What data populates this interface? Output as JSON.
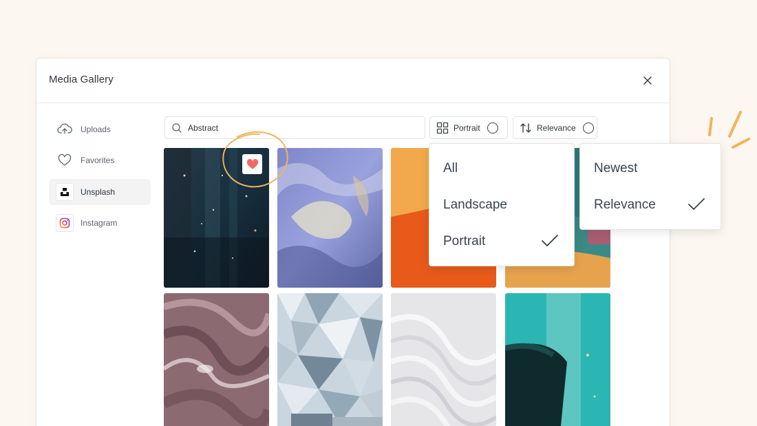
{
  "dialog": {
    "title": "Media Gallery"
  },
  "sidebar": {
    "items": [
      {
        "label": "Uploads",
        "icon": "cloud-upload-icon"
      },
      {
        "label": "Favorites",
        "icon": "heart-outline-icon"
      },
      {
        "label": "Unsplash",
        "icon": "unsplash-logo-icon",
        "active": true
      },
      {
        "label": "Instagram",
        "icon": "instagram-logo-icon"
      }
    ]
  },
  "search": {
    "value": "Abstract",
    "placeholder": ""
  },
  "filters": {
    "orientation": {
      "label": "Portrait",
      "icon": "grid-icon"
    },
    "sort": {
      "label": "Relevance",
      "icon": "sort-arrows-icon"
    }
  },
  "orientation_menu": {
    "options": [
      "All",
      "Landscape",
      "Portrait"
    ],
    "selected": "Portrait"
  },
  "sort_menu": {
    "options": [
      "Newest",
      "Relevance"
    ],
    "selected": "Relevance"
  },
  "gallery": {
    "favorited_index": 0,
    "tiles": [
      "dark-blue-bokeh",
      "purple-crumpled-foil",
      "orange-gradient",
      "teal-orange-paint",
      "mauve-marble-swirl",
      "geometric-glass-facade",
      "white-waves",
      "teal-black-paint"
    ]
  },
  "colors": {
    "background": "#fdf7f1",
    "accent_heart": "#f06a6a",
    "annotation_orange": "#f0b45a"
  }
}
